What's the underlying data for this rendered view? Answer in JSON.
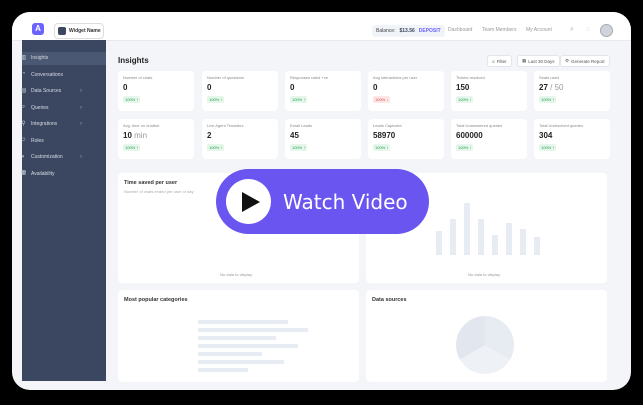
{
  "topbar": {
    "widget_label": "Widget Name",
    "balance_label": "Balance:",
    "balance_value": "$13.56",
    "deposit": "DEPOSIT",
    "nav": [
      "Dashboard",
      "Team Members",
      "My Account"
    ]
  },
  "sidebar": {
    "items": [
      {
        "label": "Insights",
        "icon": "chart-icon",
        "chevron": false
      },
      {
        "label": "Conversations",
        "icon": "chat-icon",
        "chevron": false
      },
      {
        "label": "Data Sources",
        "icon": "database-icon",
        "chevron": true
      },
      {
        "label": "Queries",
        "icon": "search-icon",
        "chevron": true
      },
      {
        "label": "Integrations",
        "icon": "plug-icon",
        "chevron": true
      },
      {
        "label": "Roles",
        "icon": "users-icon",
        "chevron": false
      },
      {
        "label": "Customization",
        "icon": "palette-icon",
        "chevron": true
      },
      {
        "label": "Availability",
        "icon": "calendar-icon",
        "chevron": false
      }
    ]
  },
  "main": {
    "title": "Insights",
    "filter_label": "Filter",
    "range_label": "Last 30 Days",
    "report_label": "Generate Report"
  },
  "cards": [
    {
      "label": "Number of chats",
      "value": "0",
      "sub": "",
      "badge": "100% ↑",
      "bad": false
    },
    {
      "label": "Number of questions",
      "value": "0",
      "sub": "",
      "badge": "100% ↑",
      "bad": false
    },
    {
      "label": "Responses rated +ve",
      "value": "0",
      "sub": "",
      "badge": "100% ↑",
      "bad": false
    },
    {
      "label": "Avg interactions per user",
      "value": "0",
      "sub": "",
      "badge": "100% ↓",
      "bad": true
    },
    {
      "label": "Tickets resolved",
      "value": "150",
      "sub": "",
      "badge": "100% ↑",
      "bad": false
    },
    {
      "label": "Seats used",
      "value": "27",
      "sub": " / 50",
      "badge": "100% ↑",
      "bad": false
    },
    {
      "label": "Avg. time on chatbot",
      "value": "10",
      "sub": " min",
      "badge": "100% ↑",
      "bad": false
    },
    {
      "label": "Live Agent Transfers",
      "value": "2",
      "sub": "",
      "badge": "100% ↑",
      "bad": false
    },
    {
      "label": "Email Leads",
      "value": "45",
      "sub": "",
      "badge": "100% ↑",
      "bad": false
    },
    {
      "label": "Leads Captured",
      "value": "58970",
      "sub": "",
      "badge": "100% ↑",
      "bad": false
    },
    {
      "label": "Total Unanswered queries",
      "value": "600000",
      "sub": "",
      "badge": "100% ↑",
      "bad": false
    },
    {
      "label": "Total Unresolved queries",
      "value": "304",
      "sub": "",
      "badge": "100% ↑",
      "bad": false
    }
  ],
  "panels": {
    "time_saved_title": "Time saved per user",
    "time_saved_sub": "Number of chats ended per user or day",
    "no_data": "No data to display",
    "popular_title": "Most popular categories",
    "sources_title": "Data sources"
  },
  "overlay": {
    "watch_label": "Watch Video"
  }
}
